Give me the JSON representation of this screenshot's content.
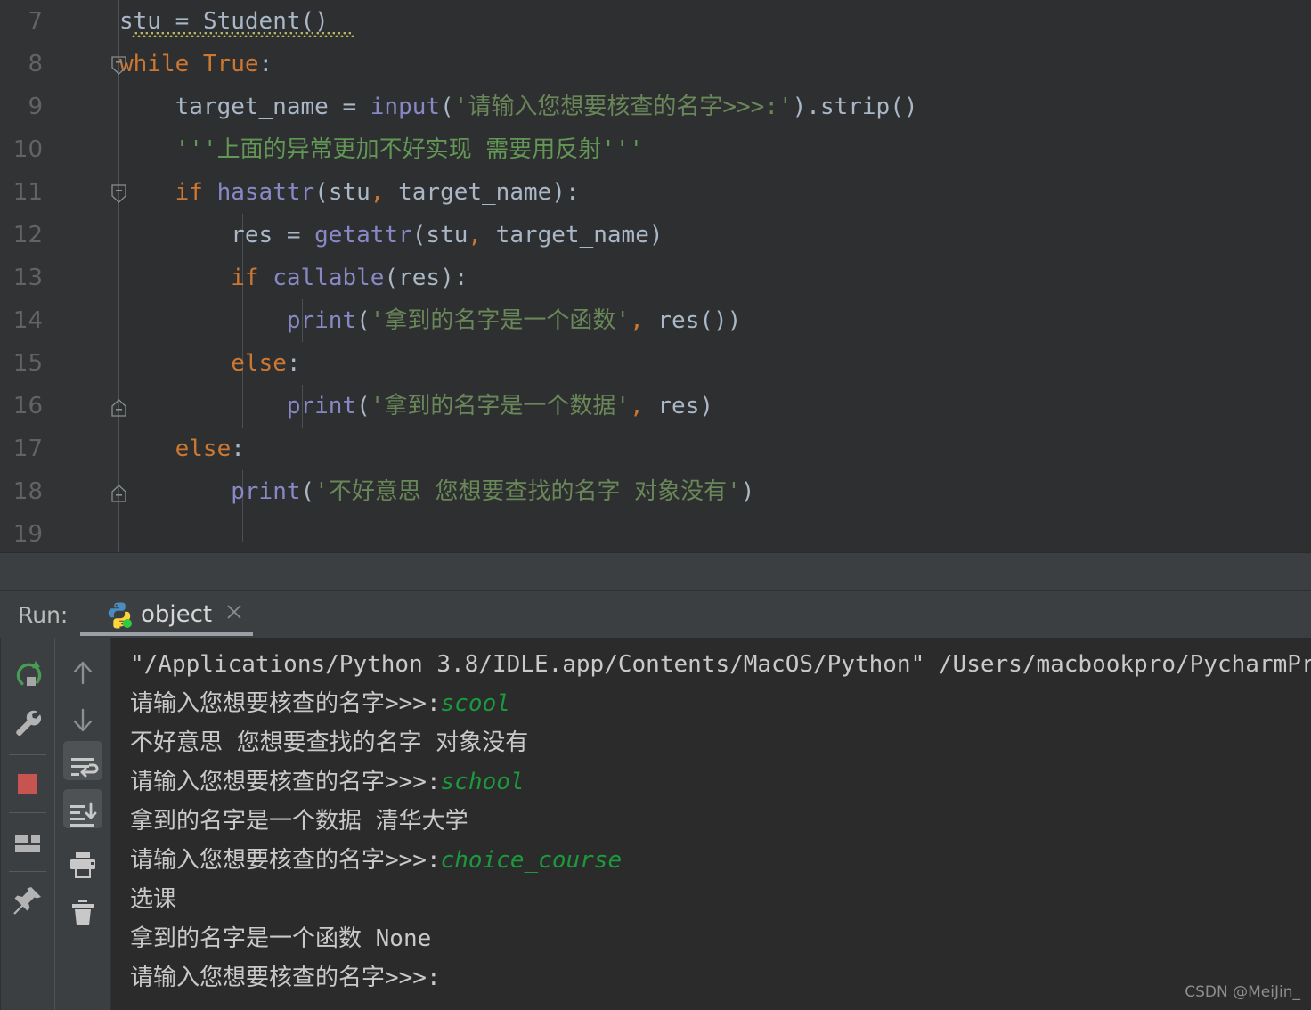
{
  "editor": {
    "lines": [
      {
        "num": "7",
        "indent": 0,
        "tokens": [
          {
            "t": "stu ",
            "c": "def"
          },
          {
            "t": "= ",
            "c": "pun"
          },
          {
            "t": "Student",
            "c": "def"
          },
          {
            "t": "()",
            "c": "pun"
          }
        ]
      },
      {
        "num": "8",
        "indent": 0,
        "tokens": [
          {
            "t": "while ",
            "c": "kw"
          },
          {
            "t": "True",
            "c": "kw"
          },
          {
            "t": ":",
            "c": "pun"
          }
        ]
      },
      {
        "num": "9",
        "indent": 0,
        "tokens": [
          {
            "t": "    target_name ",
            "c": "def"
          },
          {
            "t": "= ",
            "c": "pun"
          },
          {
            "t": "input",
            "c": "fn"
          },
          {
            "t": "(",
            "c": "pun"
          },
          {
            "t": "'请输入您想要核查的名字>>>:'",
            "c": "str"
          },
          {
            "t": ").",
            "c": "pun"
          },
          {
            "t": "strip",
            "c": "def"
          },
          {
            "t": "()",
            "c": "pun"
          }
        ]
      },
      {
        "num": "10",
        "indent": 0,
        "tokens": [
          {
            "t": "    '''上面的异常更加不好实现 需要用反射'''",
            "c": "com"
          }
        ]
      },
      {
        "num": "11",
        "indent": 0,
        "tokens": [
          {
            "t": "    ",
            "c": "def"
          },
          {
            "t": "if ",
            "c": "kw"
          },
          {
            "t": "hasattr",
            "c": "fn"
          },
          {
            "t": "(",
            "c": "pun"
          },
          {
            "t": "stu",
            "c": "def"
          },
          {
            "t": ",",
            "c": "cm"
          },
          {
            "t": " target_name",
            "c": "def"
          },
          {
            "t": "):",
            "c": "pun"
          }
        ]
      },
      {
        "num": "12",
        "indent": 0,
        "tokens": [
          {
            "t": "        res ",
            "c": "def"
          },
          {
            "t": "= ",
            "c": "pun"
          },
          {
            "t": "getattr",
            "c": "fn"
          },
          {
            "t": "(",
            "c": "pun"
          },
          {
            "t": "stu",
            "c": "def"
          },
          {
            "t": ",",
            "c": "cm"
          },
          {
            "t": " target_name",
            "c": "def"
          },
          {
            "t": ")",
            "c": "pun"
          }
        ]
      },
      {
        "num": "13",
        "indent": 0,
        "tokens": [
          {
            "t": "        ",
            "c": "def"
          },
          {
            "t": "if ",
            "c": "kw"
          },
          {
            "t": "callable",
            "c": "fn"
          },
          {
            "t": "(",
            "c": "pun"
          },
          {
            "t": "res",
            "c": "def"
          },
          {
            "t": "):",
            "c": "pun"
          }
        ]
      },
      {
        "num": "14",
        "indent": 0,
        "tokens": [
          {
            "t": "            ",
            "c": "def"
          },
          {
            "t": "print",
            "c": "fn"
          },
          {
            "t": "(",
            "c": "pun"
          },
          {
            "t": "'拿到的名字是一个函数'",
            "c": "str"
          },
          {
            "t": ",",
            "c": "cm"
          },
          {
            "t": " res",
            "c": "def"
          },
          {
            "t": "())",
            "c": "pun"
          }
        ]
      },
      {
        "num": "15",
        "indent": 0,
        "tokens": [
          {
            "t": "        ",
            "c": "def"
          },
          {
            "t": "else",
            "c": "kw"
          },
          {
            "t": ":",
            "c": "pun"
          }
        ]
      },
      {
        "num": "16",
        "indent": 0,
        "tokens": [
          {
            "t": "            ",
            "c": "def"
          },
          {
            "t": "print",
            "c": "fn"
          },
          {
            "t": "(",
            "c": "pun"
          },
          {
            "t": "'拿到的名字是一个数据'",
            "c": "str"
          },
          {
            "t": ",",
            "c": "cm"
          },
          {
            "t": " res",
            "c": "def"
          },
          {
            "t": ")",
            "c": "pun"
          }
        ]
      },
      {
        "num": "17",
        "indent": 0,
        "tokens": [
          {
            "t": "    ",
            "c": "def"
          },
          {
            "t": "else",
            "c": "kw"
          },
          {
            "t": ":",
            "c": "pun"
          }
        ]
      },
      {
        "num": "18",
        "indent": 0,
        "tokens": [
          {
            "t": "        ",
            "c": "def"
          },
          {
            "t": "print",
            "c": "fn"
          },
          {
            "t": "(",
            "c": "pun"
          },
          {
            "t": "'不好意思 您想要查找的名字 对象没有'",
            "c": "str"
          },
          {
            "t": ")",
            "c": "pun"
          }
        ]
      },
      {
        "num": "19",
        "indent": 0,
        "tokens": []
      }
    ]
  },
  "run_panel": {
    "label": "Run:",
    "tab_title": "object",
    "tab_icon": "python-icon",
    "close_icon": "close-icon",
    "toolbar_left": [
      {
        "name": "rerun-button",
        "icon": "rerun-icon"
      },
      {
        "name": "edit-configurations-button",
        "icon": "wrench-icon"
      },
      {
        "name": "stop-button",
        "icon": "stop-icon"
      },
      {
        "name": "restore-layout-button",
        "icon": "layout-icon"
      },
      {
        "name": "pin-tab-button",
        "icon": "pin-icon"
      }
    ],
    "toolbar_right": [
      {
        "name": "previous-occurrence-button",
        "icon": "arrow-up-icon"
      },
      {
        "name": "next-occurrence-button",
        "icon": "arrow-down-icon"
      },
      {
        "name": "soft-wrap-button",
        "icon": "soft-wrap-icon"
      },
      {
        "name": "scroll-to-end-button",
        "icon": "scroll-to-end-icon"
      },
      {
        "name": "print-button",
        "icon": "printer-icon"
      },
      {
        "name": "clear-all-button",
        "icon": "trash-icon"
      }
    ]
  },
  "console": {
    "lines": [
      {
        "segments": [
          {
            "t": "\"/Applications/Python 3.8/IDLE.app/Contents/MacOS/Python\" /Users/macbookpro/PycharmPr",
            "k": "out"
          }
        ]
      },
      {
        "segments": [
          {
            "t": "请输入您想要核查的名字>>>:",
            "k": "out"
          },
          {
            "t": "scool",
            "k": "in"
          }
        ]
      },
      {
        "segments": [
          {
            "t": "不好意思 您想要查找的名字 对象没有",
            "k": "out"
          }
        ]
      },
      {
        "segments": [
          {
            "t": "请输入您想要核查的名字>>>:",
            "k": "out"
          },
          {
            "t": "school",
            "k": "in"
          }
        ]
      },
      {
        "segments": [
          {
            "t": "拿到的名字是一个数据 清华大学",
            "k": "out"
          }
        ]
      },
      {
        "segments": [
          {
            "t": "请输入您想要核查的名字>>>:",
            "k": "out"
          },
          {
            "t": "choice_course",
            "k": "in"
          }
        ]
      },
      {
        "segments": [
          {
            "t": "选课",
            "k": "out"
          }
        ]
      },
      {
        "segments": [
          {
            "t": "拿到的名字是一个函数 None",
            "k": "out"
          }
        ]
      },
      {
        "segments": [
          {
            "t": "请输入您想要核查的名字>>>:",
            "k": "out"
          }
        ]
      }
    ]
  },
  "watermark": "CSDN @MeiJin_",
  "colors": {
    "editor_bg": "#2e2f30",
    "gutter_bg": "#313335",
    "console_bg": "#2b2b2b",
    "panel_bg": "#3c3f41",
    "keyword": "#cc7832",
    "function": "#8888c6",
    "string": "#6a8759",
    "comment": "#629755",
    "text": "#a9b7c6",
    "input_echo": "#1a9a3c",
    "stop_red": "#c75450",
    "rerun_green": "#499c54"
  }
}
